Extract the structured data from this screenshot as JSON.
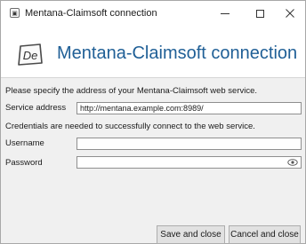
{
  "window": {
    "title": "Mentana-Claimsoft connection",
    "icon": "app-window-icon",
    "controls": [
      "minimize-icon",
      "maximize-icon",
      "close-icon"
    ]
  },
  "header": {
    "logo_text": "De",
    "title": "Mentana-Claimsoft connection",
    "title_color": "#1f5f96"
  },
  "form": {
    "intro": "Please specify the address of your Mentana-Claimsoft web service.",
    "service_address_label": "Service address",
    "service_address_value": "http://mentana.example.com:8989/",
    "credentials_note": "Credentials are needed to successfully connect to the web service.",
    "username_label": "Username",
    "username_value": "",
    "password_label": "Password",
    "password_value": "",
    "password_toggle_icon": "eye-icon"
  },
  "footer": {
    "save_label": "Save and close",
    "cancel_label": "Cancel and close"
  }
}
